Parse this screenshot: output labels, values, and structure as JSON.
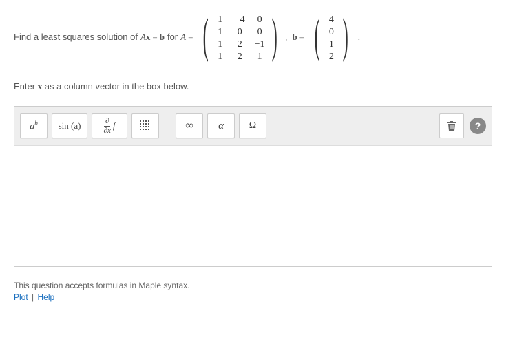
{
  "question": {
    "prefix": "Find a least squares solution of",
    "expr_lhs_A": "A",
    "expr_lhs_x": "x",
    "eq": "=",
    "expr_lhs_b": "b",
    "for": "for",
    "A_sym": "A",
    "comma": ",",
    "b_sym": "b",
    "period": ".",
    "matrix_A": {
      "rows": 4,
      "cols": 3,
      "values": [
        "1",
        "−4",
        "0",
        "1",
        "0",
        "0",
        "1",
        "2",
        "−1",
        "1",
        "2",
        "1"
      ]
    },
    "matrix_b": {
      "rows": 4,
      "cols": 1,
      "values": [
        "4",
        "0",
        "1",
        "2"
      ]
    }
  },
  "instruction_prefix": "Enter ",
  "instruction_var": "x",
  "instruction_suffix": " as a column vector in the box below.",
  "toolbar": {
    "ab": {
      "base": "a",
      "sup": "b"
    },
    "sin": "sin (a)",
    "partial_top": "∂",
    "partial_bot": "∂x",
    "partial_f": "f",
    "infinity": "∞",
    "alpha": "α",
    "omega": "Ω"
  },
  "footer": {
    "note": "This question accepts formulas in Maple syntax.",
    "plot": "Plot",
    "sep": "|",
    "help": "Help"
  }
}
